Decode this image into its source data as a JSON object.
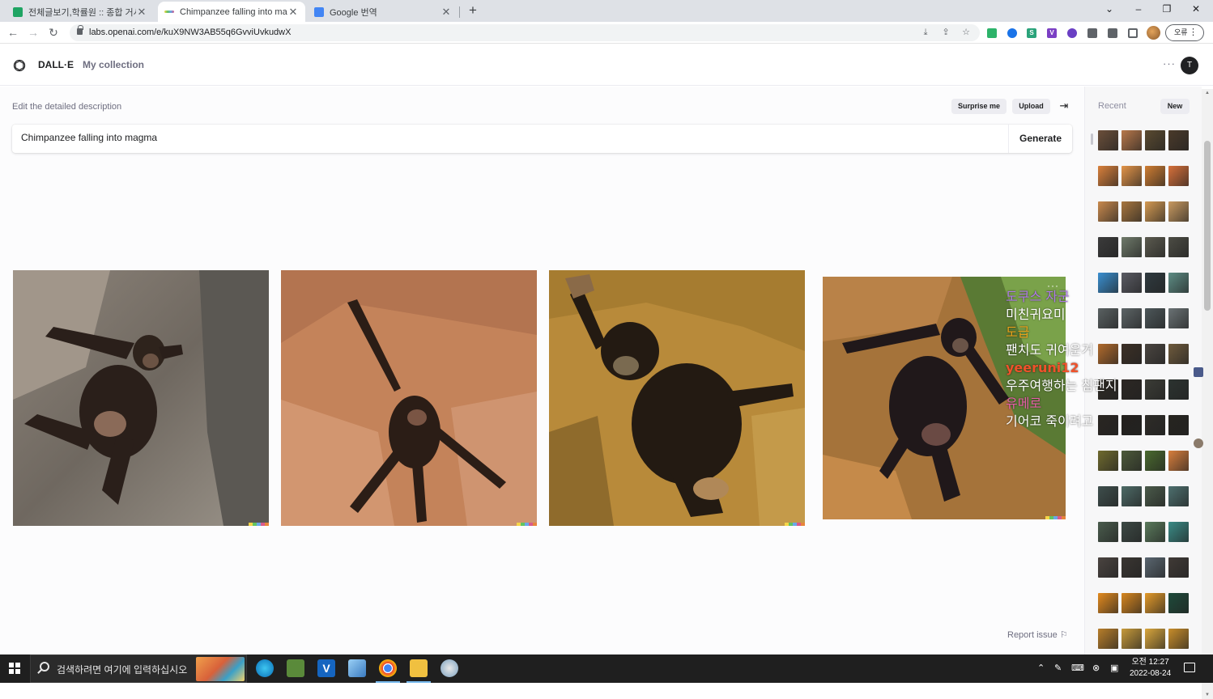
{
  "browser": {
    "tabs": [
      {
        "title": "전체글보기,학률원 :: 종합 거시기",
        "active": false,
        "favicon_color": "#1fa463"
      },
      {
        "title": "Chimpanzee falling into magma",
        "active": true,
        "favicon_color": "#a7a7a7"
      },
      {
        "title": "Google 번역",
        "active": false,
        "favicon_color": "#4285f4"
      }
    ],
    "new_tab": "+",
    "window_controls": {
      "collapse": "⌄",
      "minimize": "–",
      "restore": "❐",
      "close": "✕"
    },
    "url": "labs.openai.com/e/kuX9NW3AB55q6GvviUvkudwX",
    "profile_error_label": "오류"
  },
  "app": {
    "brand": "DALL·E",
    "nav_collection": "My collection",
    "avatar_initial": "T",
    "more": "···"
  },
  "editor": {
    "label": "Edit the detailed description",
    "surprise_label": "Surprise me",
    "upload_label": "Upload",
    "prompt_value": "Chimpanzee falling into magma",
    "generate_label": "Generate",
    "report_label": "Report issue"
  },
  "results": [
    {
      "alt": "chimpanzee image 1"
    },
    {
      "alt": "chimpanzee image 2"
    },
    {
      "alt": "chimpanzee image 3"
    },
    {
      "alt": "chimpanzee image 4"
    }
  ],
  "overlay_chat": [
    {
      "text": "도쿠스 자군",
      "color": "#b07be8"
    },
    {
      "text": "미친귀요미",
      "color": "#ffffff"
    },
    {
      "text": "도급",
      "color": "#e8a31c"
    },
    {
      "text": "팬치도 귀여운거",
      "color": "#ffffff"
    },
    {
      "text": "yeeruni12",
      "color": "#f0522b"
    },
    {
      "text": "우주여행하는 침팬지",
      "color": "#ffffff"
    },
    {
      "text": "유메로",
      "color": "#e860a8"
    },
    {
      "text": "기어코 죽이려고",
      "color": "#ffffff"
    }
  ],
  "sidebar": {
    "recent_label": "Recent",
    "new_label": "New",
    "thumb_rows": [
      [
        "#6b4f3a",
        "#b8784a",
        "#5a4a30",
        "#4a3a2a"
      ],
      [
        "#d9803b",
        "#e39448",
        "#cf7d32",
        "#d7703a"
      ],
      [
        "#c98a4d",
        "#a8773f",
        "#d49a52",
        "#c99a60"
      ],
      [
        "#3b3b3b",
        "#6f7a6a",
        "#5b5a4f",
        "#4c4c44"
      ],
      [
        "#3a8fd0",
        "#5a5b63",
        "#2f3a3f",
        "#5d8c84"
      ],
      [
        "#5a6162",
        "#5d6567",
        "#4d575a",
        "#6a7274"
      ],
      [
        "#b06a2c",
        "#3c3026",
        "#4a4540",
        "#6e5a3c"
      ],
      [
        "#2e2a24",
        "#2c2723",
        "#3b3c36",
        "#2c3330"
      ],
      [
        "#2a2622",
        "#24211e",
        "#2e2c28",
        "#26241f"
      ],
      [
        "#6f6a2e",
        "#4d5a3a",
        "#4a6a2e",
        "#d87e3c"
      ],
      [
        "#3e4e4c",
        "#4d6a66",
        "#4a5a4a",
        "#4d6f6e"
      ],
      [
        "#4a5c4d",
        "#3d4a45",
        "#5a7a5c",
        "#3a8b86"
      ],
      [
        "#4a4440",
        "#3a3632",
        "#5a6670",
        "#403a36"
      ],
      [
        "#e28a1e",
        "#d7861e",
        "#e39a2a",
        "#1e4a3a"
      ],
      [
        "#b87e2a",
        "#c79a3a",
        "#d9a63c",
        "#c88d2a"
      ]
    ]
  },
  "taskbar": {
    "search_placeholder": "검색하려면 여기에 입력하십시오",
    "clock_time": "오전 12:27",
    "clock_date": "2022-08-24"
  }
}
